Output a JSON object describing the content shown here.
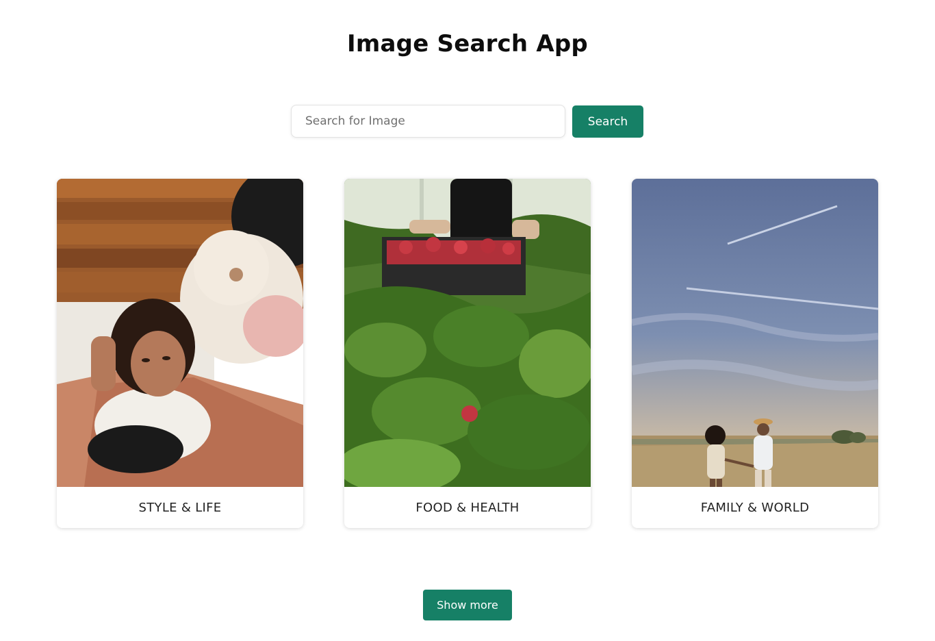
{
  "header": {
    "title": "Image Search App"
  },
  "search": {
    "placeholder": "Search for Image",
    "value": "",
    "button_label": "Search"
  },
  "cards": [
    {
      "label": "STYLE & LIFE"
    },
    {
      "label": "FOOD & HEALTH"
    },
    {
      "label": "FAMILY & WORLD"
    }
  ],
  "footer": {
    "show_more_label": "Show more"
  },
  "colors": {
    "accent": "#168066",
    "background": "#ffffff",
    "text": "#111111"
  }
}
